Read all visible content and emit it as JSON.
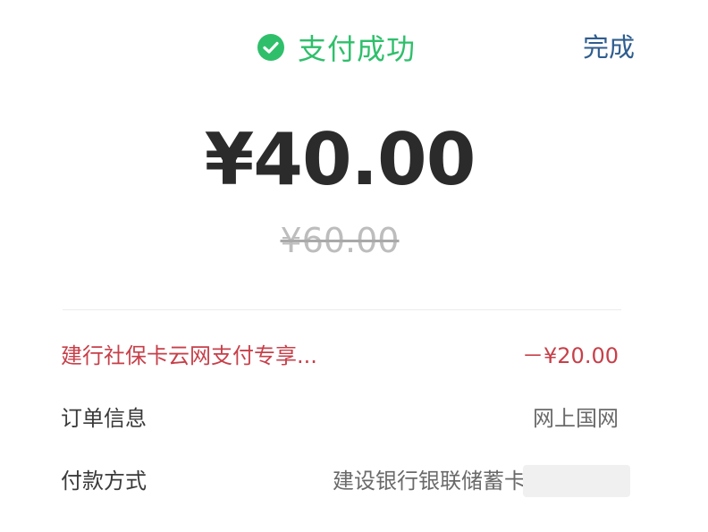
{
  "header": {
    "status_text": "支付成功",
    "status_icon": "check-circle-icon",
    "done_label": "完成",
    "status_color": "#2fbf6b"
  },
  "payment": {
    "amount": "¥40.00",
    "original_amount": "¥60.00"
  },
  "details": {
    "discount": {
      "label": "建行社保卡云网支付专享...",
      "value": "－¥20.00"
    },
    "order_info": {
      "label": "订单信息",
      "value": "网上国网"
    },
    "payment_method": {
      "label": "付款方式",
      "value": "建设银行银联储蓄卡"
    }
  }
}
